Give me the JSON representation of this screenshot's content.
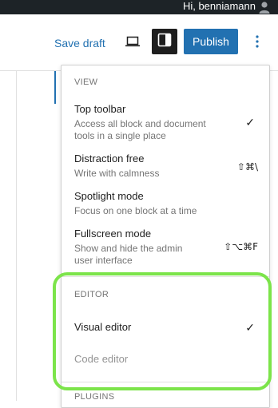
{
  "admin_bar": {
    "greeting": "Hi, benniamann"
  },
  "header": {
    "save_draft_label": "Save draft",
    "publish_label": "Publish"
  },
  "menu": {
    "view": {
      "label": "VIEW",
      "items": [
        {
          "title": "Top toolbar",
          "desc": "Access all block and document tools in a single place",
          "checked": "✓",
          "shortcut": ""
        },
        {
          "title": "Distraction free",
          "desc": "Write with calmness",
          "checked": "",
          "shortcut": "⇧⌘\\"
        },
        {
          "title": "Spotlight mode",
          "desc": "Focus on one block at a time",
          "checked": "",
          "shortcut": ""
        },
        {
          "title": "Fullscreen mode",
          "desc": "Show and hide the admin user interface",
          "checked": "",
          "shortcut": "⇧⌥⌘F"
        }
      ]
    },
    "editor": {
      "label": "EDITOR",
      "items": [
        {
          "title": "Visual editor",
          "checked": "✓"
        },
        {
          "title": "Code editor",
          "checked": ""
        }
      ]
    },
    "plugins": {
      "label": "PLUGINS"
    }
  },
  "colors": {
    "accent": "#2271b1",
    "admin_bar": "#1d2327",
    "highlight": "#7ce44a"
  }
}
